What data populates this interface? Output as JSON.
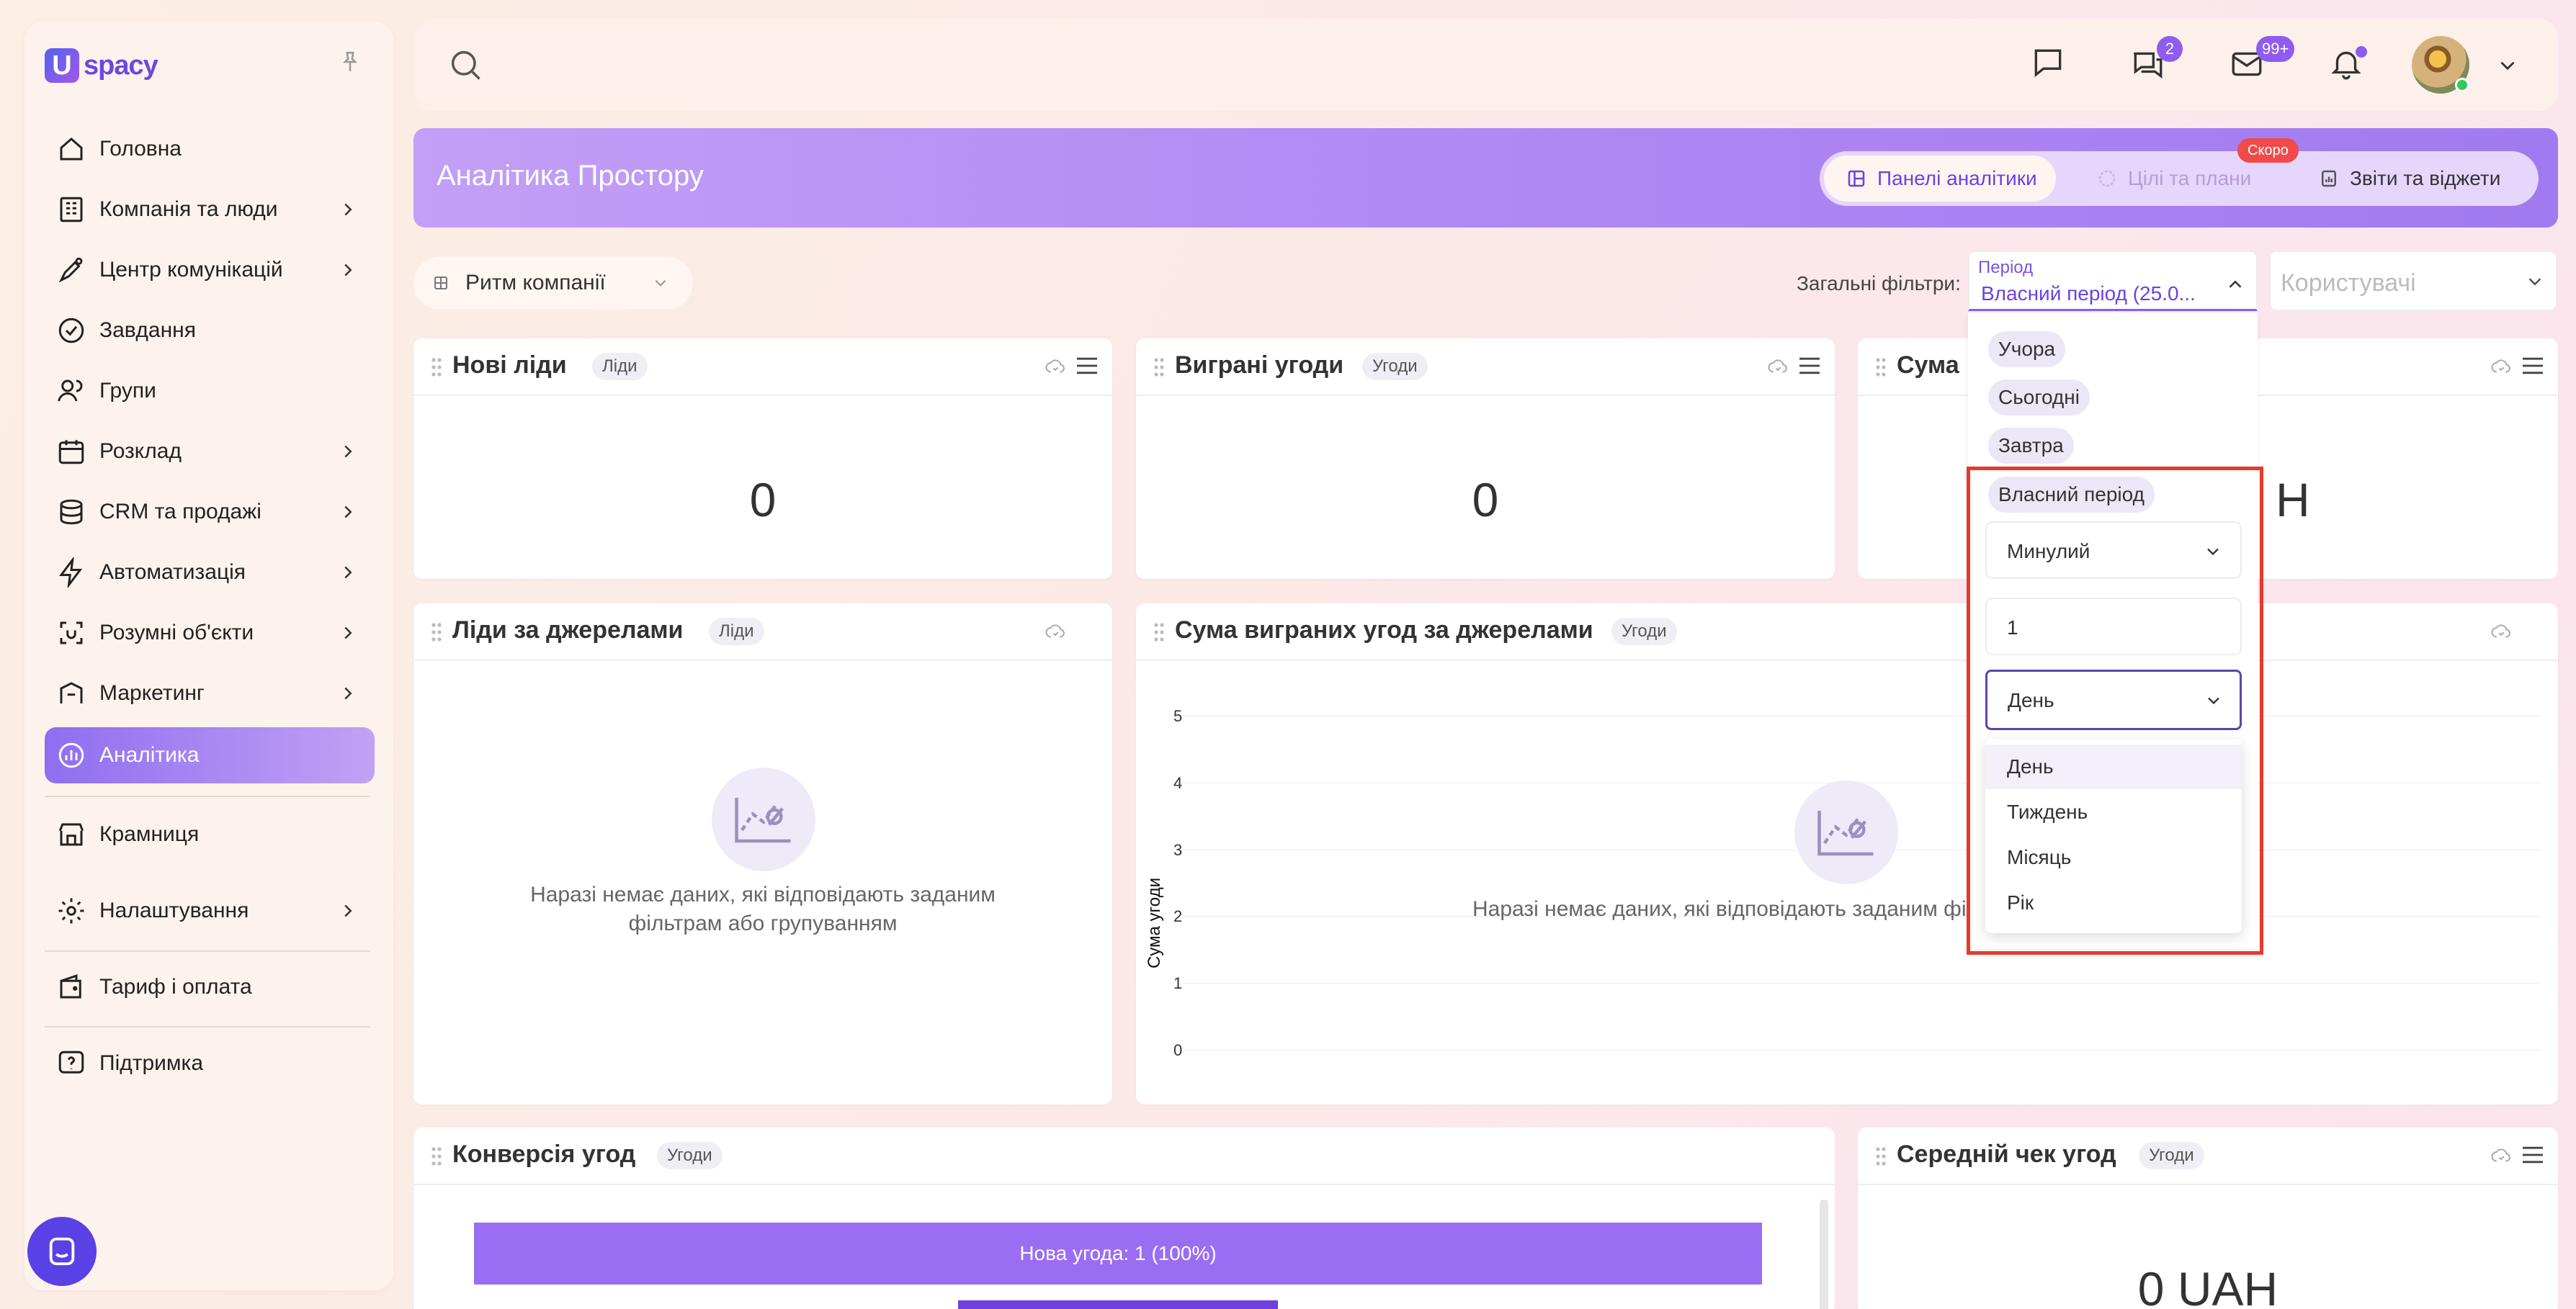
{
  "app": {
    "logo_text": "spacy",
    "logo_letter": "U"
  },
  "sidebar": {
    "items": [
      {
        "label": "Головна",
        "icon": "home-icon",
        "chevron": false
      },
      {
        "label": "Компанія та люди",
        "icon": "company-icon",
        "chevron": true
      },
      {
        "label": "Центр комунікацій",
        "icon": "communications-icon",
        "chevron": true
      },
      {
        "label": "Завдання",
        "icon": "tasks-icon",
        "chevron": false
      },
      {
        "label": "Групи",
        "icon": "groups-icon",
        "chevron": false
      },
      {
        "label": "Розклад",
        "icon": "calendar-icon",
        "chevron": true
      },
      {
        "label": "CRM та продажі",
        "icon": "crm-icon",
        "chevron": true
      },
      {
        "label": "Автоматизація",
        "icon": "automation-icon",
        "chevron": true
      },
      {
        "label": "Розумні об'єкти",
        "icon": "smart-objects-icon",
        "chevron": true
      },
      {
        "label": "Маркетинг",
        "icon": "marketing-icon",
        "chevron": true
      },
      {
        "label": "Аналітика",
        "icon": "analytics-icon",
        "chevron": false,
        "active": true
      },
      {
        "label": "Крамниця",
        "icon": "store-icon",
        "chevron": false
      },
      {
        "label": "Налаштування",
        "icon": "settings-icon",
        "chevron": true
      },
      {
        "label": "Тариф і оплата",
        "icon": "wallet-icon",
        "chevron": false
      },
      {
        "label": "Підтримка",
        "icon": "support-icon",
        "chevron": false
      }
    ]
  },
  "topbar": {
    "chat_badge": "2",
    "mail_badge": "99+"
  },
  "header": {
    "title": "Аналітика Простору",
    "tabs": [
      {
        "label": "Панелі аналітики",
        "active": true
      },
      {
        "label": "Цілі та плани",
        "disabled": true,
        "badge": "Скоро"
      },
      {
        "label": "Звіти та віджети"
      }
    ]
  },
  "dashboard_select": {
    "value": "Ритм компанії"
  },
  "filters": {
    "label": "Загальні фільтри:",
    "period_label": "Період",
    "period_value": "Власний період (25.0...",
    "users_placeholder": "Користувачі",
    "presets": [
      "Учора",
      "Сьогодні",
      "Завтра",
      "Власний період"
    ],
    "custom": {
      "direction": "Минулий",
      "amount": "1",
      "unit": "День",
      "unit_options": [
        "День",
        "Тиждень",
        "Місяць",
        "Рік"
      ],
      "unit_selected": "День"
    }
  },
  "widgets": {
    "new_leads": {
      "title": "Нові ліди",
      "tag": "Ліди",
      "value": "0"
    },
    "won_deals": {
      "title": "Виграні угоди",
      "tag": "Угоди",
      "value": "0"
    },
    "sum": {
      "title": "Сума",
      "value_tail": "Н"
    },
    "leads_by_source": {
      "title": "Ліди за джерелами",
      "tag": "Ліди",
      "empty_text_1": "Наразі немає даних, які відповідають заданим",
      "empty_text_2": "фільтрам або групуванням"
    },
    "won_sum_by_source": {
      "title": "Сума виграних угод за джерелами",
      "tag": "Угоди",
      "empty_text": "Наразі немає даних, які відповідають заданим філ"
    },
    "deal_conversion": {
      "title": "Конверсія угод",
      "tag": "Угоди",
      "bar_text": "Нова угода: 1 (100%)"
    },
    "avg_check": {
      "title": "Середній чек угод",
      "tag": "Угоди",
      "value": "0 UAH"
    }
  },
  "chart_data": {
    "type": "bar",
    "ylabel": "Сума угоди",
    "ylim": [
      0,
      5
    ],
    "yticks": [
      "0",
      "1",
      "2",
      "3",
      "4",
      "5"
    ],
    "categories": [],
    "values": []
  },
  "colors": {
    "accent": "#8b5cf6",
    "highlight_border": "#e53a2b"
  }
}
